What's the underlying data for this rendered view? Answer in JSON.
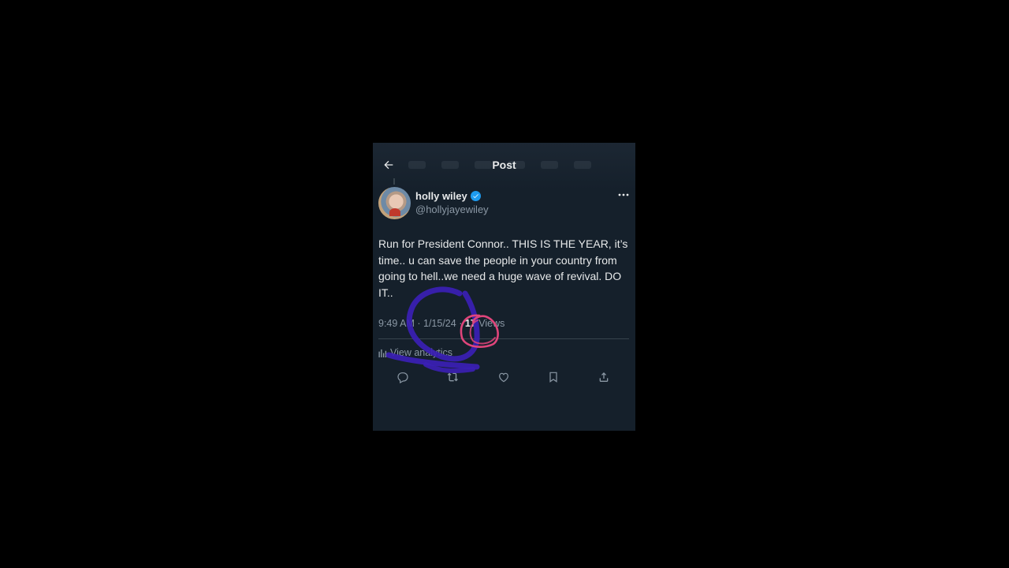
{
  "header": {
    "title": "Post",
    "back_icon": "arrow-left-icon"
  },
  "author": {
    "name": "holly wiley",
    "handle": "@hollyjayewiley",
    "verified": true
  },
  "tweet": {
    "text": "Run for President Connor.. THIS IS THE YEAR, it’s time.. u can save the people in your country from going to hell..we need a huge wave of revival. DO IT..",
    "time": "9:49 AM",
    "date": "1/15/24",
    "views_count": "17",
    "views_label": "Views"
  },
  "analytics": {
    "label": "View analytics"
  },
  "actions": [
    "reply-icon",
    "repost-icon",
    "like-icon",
    "bookmark-icon",
    "share-icon"
  ],
  "colors": {
    "background": "#15202b",
    "accent": "#1d9bf0",
    "scribble_purple": "#3b1fb5",
    "scribble_pink": "#e0457b"
  }
}
